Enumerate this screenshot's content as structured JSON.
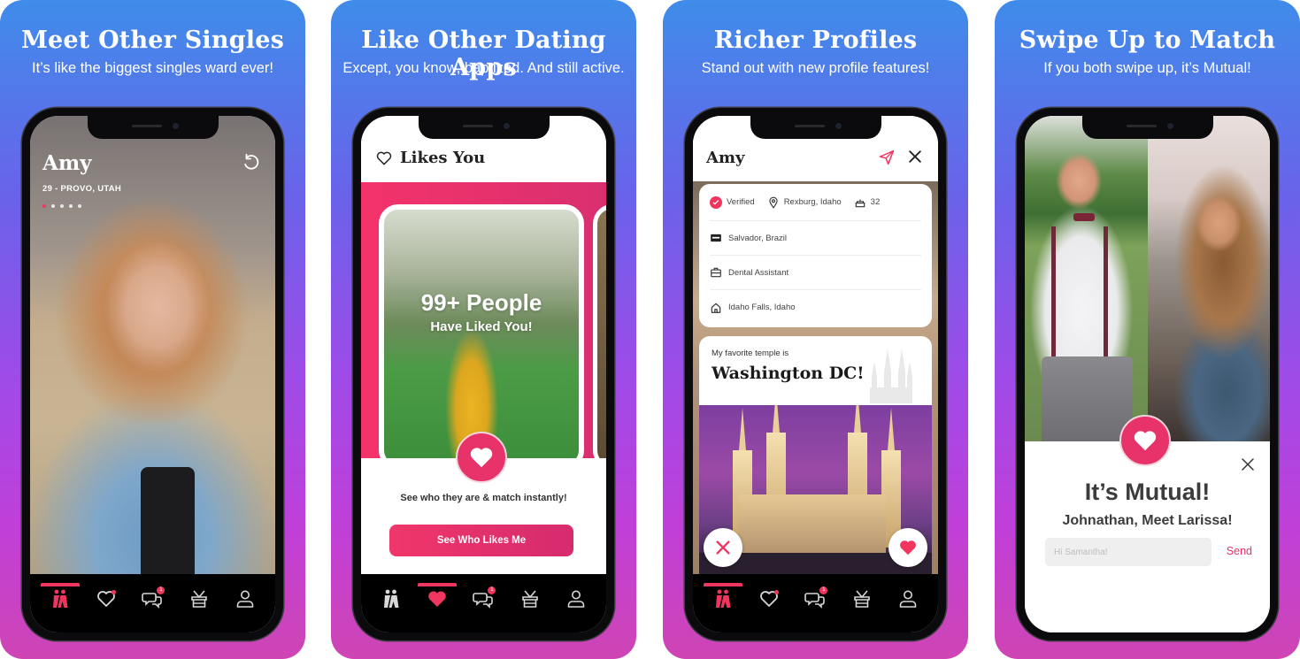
{
  "colors": {
    "accent": "#f0365f",
    "accent_deep": "#d62b6e",
    "tabbar": "#000000",
    "inactive_icon": "#d8d8d8",
    "gradient_top": "#3f8cea",
    "gradient_bottom": "#cf45b4"
  },
  "panels": [
    {
      "title": "Meet Other Singles",
      "subtitle": "It’s like the biggest singles ward ever!",
      "screen": {
        "name": "Amy",
        "meta": "29 - PROVO, UTAH",
        "photo_count": 5,
        "active_photo": 1,
        "undo_icon": "undo-icon"
      },
      "tabbar": {
        "active": "discover",
        "messages_badge": "1"
      }
    },
    {
      "title": "Like Other Dating Apps",
      "subtitle": "Except, you know, baptized. And still active.",
      "screen": {
        "header": "Likes You",
        "count_text": "99+ People",
        "count_sub": "Have Liked You!",
        "prompt": "See who they are & match instantly!",
        "button": "See Who Likes Me"
      },
      "tabbar": {
        "active": "likes",
        "messages_badge": "1"
      }
    },
    {
      "title": "Richer Profiles",
      "subtitle": "Stand out with new profile features!",
      "screen": {
        "name": "Amy",
        "verified": "Verified",
        "location": "Rexburg, Idaho",
        "age": "32",
        "mission": "Salvador, Brazil",
        "job": "Dental Assistant",
        "hometown": "Idaho Falls, Idaho",
        "temple_label": "My favorite temple is",
        "temple_name": "Washington DC!"
      },
      "tabbar": {
        "active": "discover",
        "messages_badge": "1"
      }
    },
    {
      "title": "Swipe Up to Match",
      "subtitle": "If you both swipe up, it’s Mutual!",
      "screen": {
        "title": "It’s Mutual!",
        "subtitle": "Johnathan, Meet Larissa!",
        "input_placeholder": "Hi Samantha!",
        "send": "Send"
      }
    }
  ],
  "tabs": [
    "discover",
    "likes",
    "messages",
    "activities",
    "profile"
  ]
}
